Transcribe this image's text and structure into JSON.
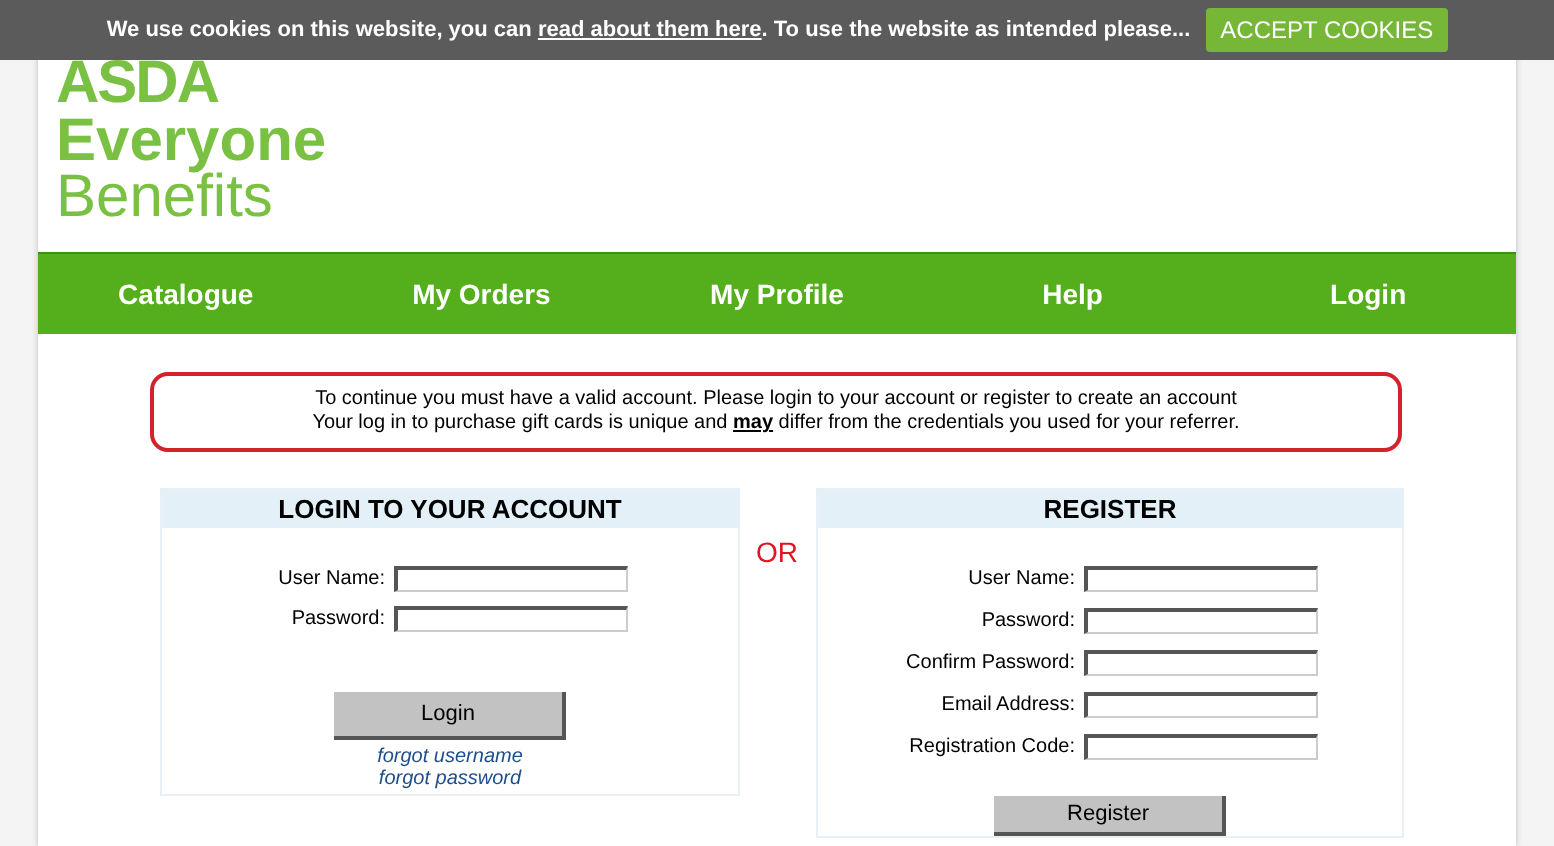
{
  "cookie_bar": {
    "text_before": "We use cookies on this website, you can",
    "link": "read about them here",
    "text_after": ". To use the website as intended please...",
    "button": "ACCEPT COOKIES"
  },
  "logo": {
    "line_1": "ASDA",
    "line_2": "Everyone",
    "line_3": "Benefits"
  },
  "nav": [
    {
      "label": "Catalogue"
    },
    {
      "label": "My Orders"
    },
    {
      "label": "My Profile"
    },
    {
      "label": "Help"
    },
    {
      "label": "Login"
    }
  ],
  "notice": {
    "lines": [
      "To continue you must have a valid account. Please login to your account or register to create an account",
      "Your log in to purchase gift cards is unique and **may** differ from the credentials you used for your referrer."
    ]
  },
  "login": {
    "title": "LOGIN TO YOUR ACCOUNT",
    "fields": [
      {
        "label": "User Name:"
      },
      {
        "label": "Password:"
      }
    ],
    "button": "Login",
    "links": [
      "forgot username",
      "forgot password"
    ]
  },
  "separator": "OR",
  "register": {
    "title": "REGISTER",
    "fields": [
      {
        "label": "User Name:"
      },
      {
        "label": "Password:"
      },
      {
        "label": "Confirm Password:"
      },
      {
        "label": "Email Address:"
      },
      {
        "label": "Registration Code:"
      }
    ],
    "button": "Register"
  }
}
